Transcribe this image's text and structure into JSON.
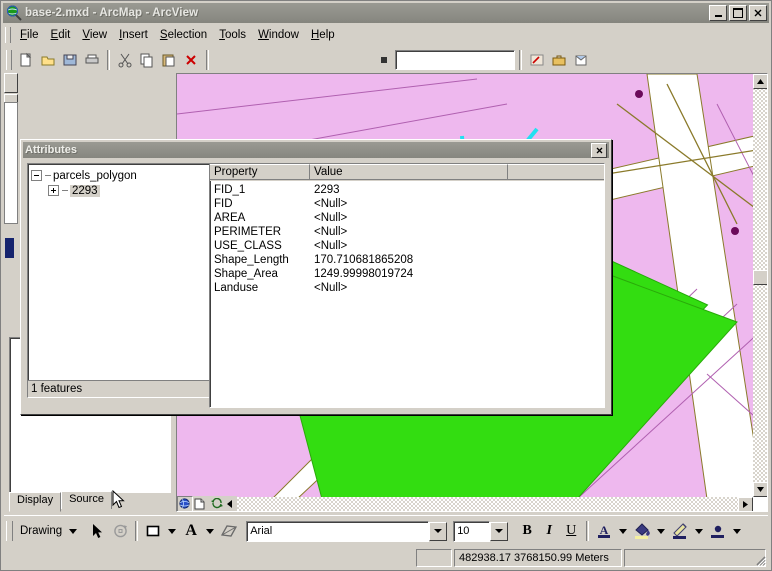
{
  "window": {
    "title": "base-2.mxd - ArcMap - ArcView",
    "app_icon": "arcmap-globe-icon",
    "buttons": [
      {
        "name": "minimize-button",
        "glyph": "_"
      },
      {
        "name": "maximize-button",
        "glyph": "□"
      },
      {
        "name": "close-button",
        "glyph": "✕"
      }
    ]
  },
  "menubar": {
    "items": [
      {
        "label": "File",
        "accel": "F"
      },
      {
        "label": "Edit",
        "accel": "E"
      },
      {
        "label": "View",
        "accel": "V"
      },
      {
        "label": "Insert",
        "accel": "I"
      },
      {
        "label": "Selection",
        "accel": "S"
      },
      {
        "label": "Tools",
        "accel": "T"
      },
      {
        "label": "Window",
        "accel": "W"
      },
      {
        "label": "Help",
        "accel": "H"
      }
    ]
  },
  "toolbars": {
    "standard_combo_value": "",
    "tools_right_top": [
      {
        "name": "find-button",
        "icon": "binoculars-icon"
      },
      {
        "name": "measure-button",
        "icon": "ruler-icon"
      },
      {
        "name": "hyperlink-button",
        "icon": "lightning-icon"
      }
    ],
    "tools_right_bottom": [
      {
        "name": "edit-tool-button",
        "icon": "pencil-line-icon"
      },
      {
        "name": "rotate-tool-button",
        "icon": "rotate-icon"
      },
      {
        "name": "attributes-button",
        "icon": "attributes-icon"
      },
      {
        "name": "open-table-button",
        "icon": "table-icon"
      }
    ]
  },
  "attributes_dialog": {
    "title": "Attributes",
    "close_label": "✕",
    "tree": {
      "root_label": "parcels_polygon",
      "child_label": "2293"
    },
    "feature_count": "1 features",
    "grid": {
      "columns": [
        "Property",
        "Value"
      ],
      "rows": [
        {
          "property": "FID_1",
          "value": "2293"
        },
        {
          "property": "FID",
          "value": "<Null>"
        },
        {
          "property": "AREA",
          "value": "<Null>"
        },
        {
          "property": "PERIMETER",
          "value": "<Null>"
        },
        {
          "property": "USE_CLASS",
          "value": "<Null>"
        },
        {
          "property": "Shape_Length",
          "value": "170.710681865208"
        },
        {
          "property": "Shape_Area",
          "value": "1249.99998019724"
        },
        {
          "property": "Landuse",
          "value": "<Null>"
        }
      ]
    }
  },
  "toc": {
    "tabs": [
      {
        "label": "Display",
        "active": true
      },
      {
        "label": "Source",
        "active": false
      }
    ],
    "items": []
  },
  "map_view": {
    "view_buttons": [
      {
        "name": "data-view-button",
        "icon": "globe-icon",
        "active": true
      },
      {
        "name": "layout-view-button",
        "icon": "page-icon",
        "active": false
      },
      {
        "name": "refresh-view-button",
        "icon": "refresh-icon",
        "active": false
      },
      {
        "name": "pause-drawing-button",
        "icon": "pause-arrow-icon",
        "active": false
      }
    ],
    "colors": {
      "parcel_fill": "#eeb8ee",
      "selected_parcel_fill": "#33dd11",
      "road_fill": "#ffffff",
      "road_casing": "#8a7a2a",
      "parcel_outline": "#b060b0",
      "selection_sketch": "#22e0f0",
      "point_marker": "#6b0a5a"
    }
  },
  "drawing_toolbar": {
    "menu_label": "Drawing",
    "select_tool": "select-elements-icon",
    "rotate_tool": "rotate-element-icon",
    "shape_tool": "new-rectangle-icon",
    "text_tool": "new-text-icon",
    "transform_tool": "transform-icon",
    "font_name": "Arial",
    "font_size": "10",
    "bold_label": "B",
    "italic_label": "I",
    "underline_label": "U",
    "font_color": "font-color-icon",
    "fill_color": "fill-color-icon",
    "line_color": "line-color-icon",
    "marker_color": "marker-color-icon"
  },
  "statusbar": {
    "left_cell": "",
    "coordinates": "482938.17  3768150.99 Meters",
    "right_cell": ""
  }
}
